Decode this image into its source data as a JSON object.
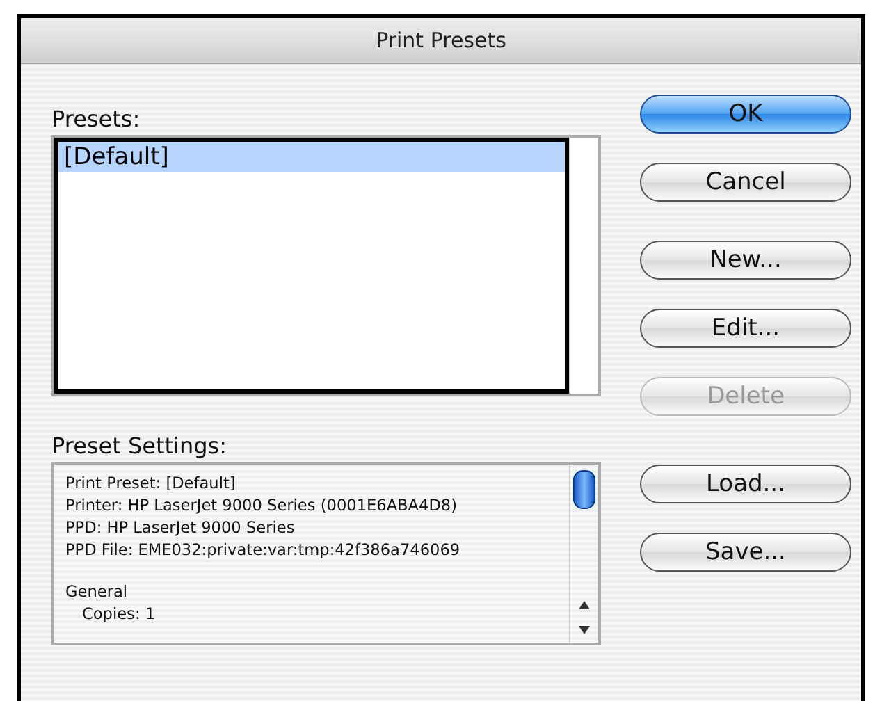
{
  "window": {
    "title": "Print Presets"
  },
  "presets": {
    "label": "Presets:",
    "items": [
      {
        "name": "[Default]",
        "selected": true
      }
    ]
  },
  "settings": {
    "label": "Preset Settings:",
    "groups": [
      [
        {
          "text": "Print Preset: [Default]"
        },
        {
          "text": "Printer: HP LaserJet 9000 Series (0001E6ABA4D8)"
        },
        {
          "text": "PPD: HP LaserJet 9000 Series"
        },
        {
          "text": "PPD File: EME032:private:var:tmp:42f386a746069"
        }
      ],
      [
        {
          "text": "General",
          "children": [
            {
              "text": "Copies: 1"
            }
          ]
        }
      ]
    ]
  },
  "button_groups": [
    [
      {
        "label": "OK",
        "default": true,
        "disabled": false
      },
      {
        "label": "Cancel",
        "default": false,
        "disabled": false
      }
    ],
    [
      {
        "label": "New...",
        "default": false,
        "disabled": false
      },
      {
        "label": "Edit...",
        "default": false,
        "disabled": false
      },
      {
        "label": "Delete",
        "default": false,
        "disabled": true
      }
    ],
    [
      {
        "label": "Load...",
        "default": false,
        "disabled": false
      },
      {
        "label": "Save...",
        "default": false,
        "disabled": false
      }
    ]
  ]
}
